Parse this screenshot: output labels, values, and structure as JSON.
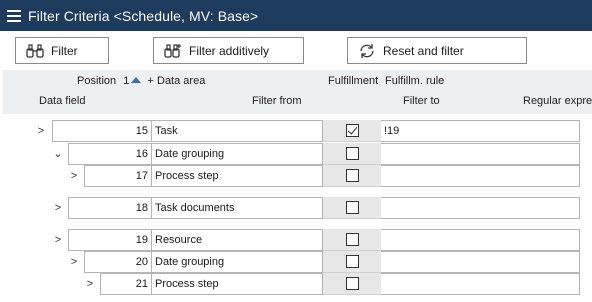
{
  "window": {
    "title": "Filter Criteria <Schedule, MV: Base>"
  },
  "toolbar": {
    "filter_label": "Filter",
    "filter_icon": "binoculars-icon",
    "filter_additively_label": "Filter additively",
    "filter_additively_icon": "binoculars-plus-icon",
    "reset_label": "Reset and filter",
    "reset_icon": "refresh-icon"
  },
  "header": {
    "position": "Position",
    "sort_order": "1",
    "add_sort": "+",
    "data_area": "Data area",
    "fulfillment": "Fulfillment",
    "fulfillment_rule": "Fulfillm. rule",
    "data_field": "Data field",
    "filter_from": "Filter from",
    "filter_to": "Filter to",
    "regular_expr": "Regular expre"
  },
  "rows": [
    {
      "expander": ">",
      "position": "15",
      "area": "Task",
      "fulfilled": true,
      "rule": "!19"
    },
    {
      "expander": "⌄",
      "position": "16",
      "area": "Date grouping",
      "fulfilled": false,
      "rule": ""
    },
    {
      "expander": ">",
      "position": "17",
      "area": "Process step",
      "fulfilled": false,
      "rule": ""
    },
    {
      "expander": ">",
      "position": "18",
      "area": "Task documents",
      "fulfilled": false,
      "rule": ""
    },
    {
      "expander": ">",
      "position": "19",
      "area": "Resource",
      "fulfilled": false,
      "rule": ""
    },
    {
      "expander": ">",
      "position": "20",
      "area": "Date grouping",
      "fulfilled": false,
      "rule": ""
    },
    {
      "expander": ">",
      "position": "21",
      "area": "Process step",
      "fulfilled": false,
      "rule": ""
    }
  ]
}
